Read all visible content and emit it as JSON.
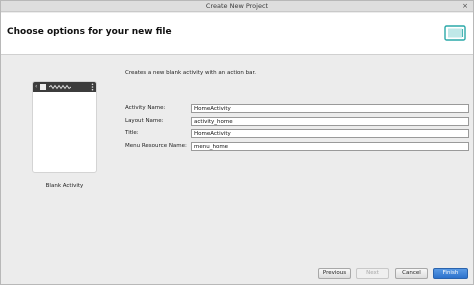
{
  "window": {
    "title": "Create New Project",
    "close_glyph": "×"
  },
  "header": {
    "heading": "Choose options for your new file",
    "icon": "device-preview-icon"
  },
  "template": {
    "caption": "Blank Activity",
    "description": "Creates a new blank activity with an action bar."
  },
  "form": {
    "fields": [
      {
        "label": "Activity Name:",
        "value": "HomeActivity"
      },
      {
        "label": "Layout Name:",
        "value": "activity_home"
      },
      {
        "label": "Title:",
        "value": "HomeActivity"
      },
      {
        "label": "Menu Resource Name:",
        "value": "menu_home"
      }
    ]
  },
  "buttons": {
    "previous": "Previous",
    "next": "Next",
    "cancel": "Cancel",
    "finish": "Finish"
  },
  "colors": {
    "primary_button": "#2d72cc",
    "preview_actionbar": "#3c3c3c",
    "device_icon": "#2aa8a8"
  }
}
